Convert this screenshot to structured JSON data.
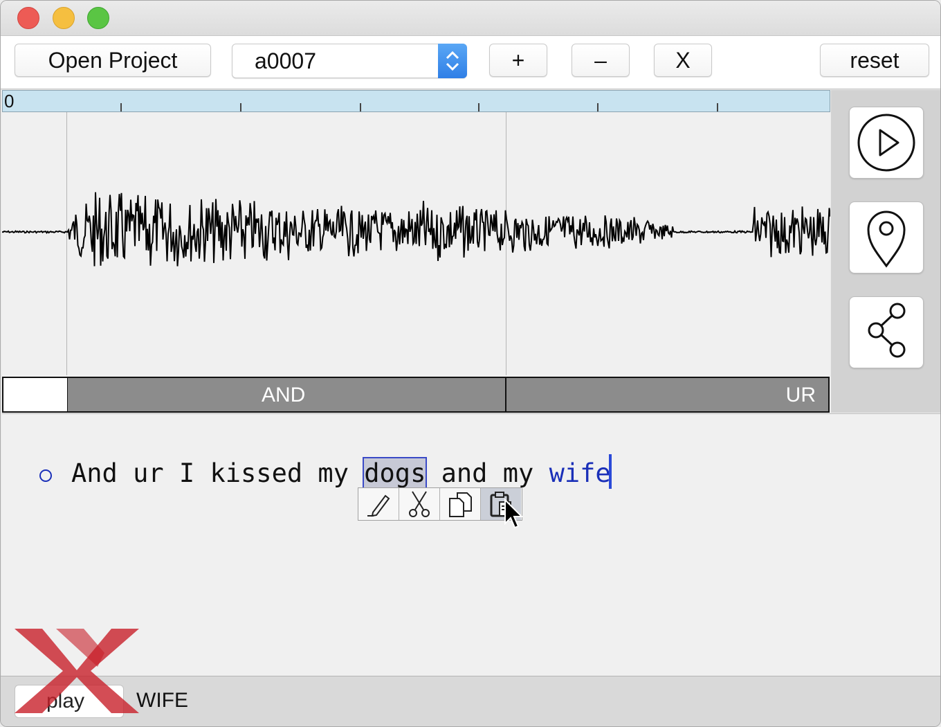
{
  "window": {
    "controls": [
      "close",
      "minimize",
      "zoom"
    ]
  },
  "toolbar": {
    "open_project_label": "Open Project",
    "recording_select_value": "a0007",
    "add_label": "+",
    "remove_label": "–",
    "close_label": "X",
    "reset_label": "reset"
  },
  "timeline": {
    "ruler_start": "0"
  },
  "segments": [
    {
      "label": ""
    },
    {
      "label": "AND"
    },
    {
      "label": "UR"
    }
  ],
  "side_tools": [
    {
      "icon": "play-circle-icon"
    },
    {
      "icon": "location-pin-icon"
    },
    {
      "icon": "share-nodes-icon"
    }
  ],
  "transcript": {
    "words_before": "And ur I kissed my ",
    "selected_word": "dogs",
    "words_middle": " and my ",
    "edited_word": "wife"
  },
  "context_menu": [
    {
      "icon": "pencil-icon"
    },
    {
      "icon": "scissors-icon"
    },
    {
      "icon": "copy-icon"
    },
    {
      "icon": "paste-icon"
    }
  ],
  "status": {
    "play_label": "play",
    "current_label": "WIFE"
  },
  "colors": {
    "ruler_bg": "#c8e3f0",
    "segment_bg": "#8c8c8c",
    "edit_blue": "#1a2fb8",
    "select_accent": "#2f7fe6"
  }
}
